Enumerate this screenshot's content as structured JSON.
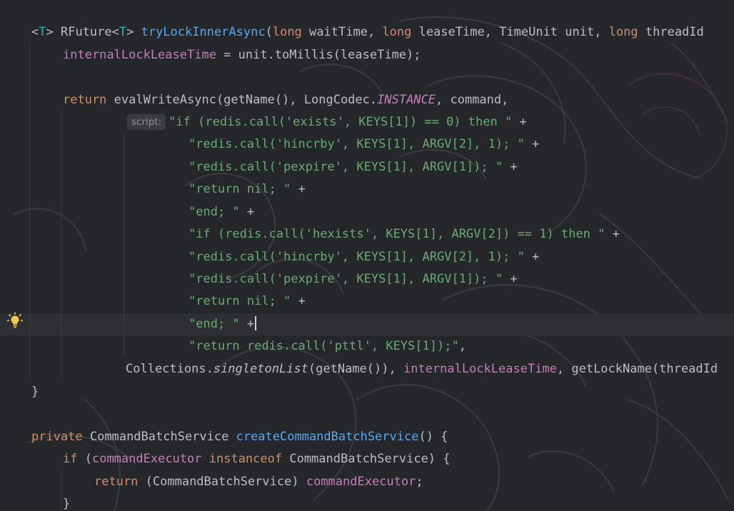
{
  "editor": {
    "language": "java",
    "inlay_hint": "script:",
    "lines": [
      {
        "tokens": [
          {
            "t": "<",
            "c": "plain"
          },
          {
            "t": "T",
            "c": "type-param"
          },
          {
            "t": "> RFuture<",
            "c": "plain"
          },
          {
            "t": "T",
            "c": "type-param"
          },
          {
            "t": "> ",
            "c": "plain"
          },
          {
            "t": "tryLockInnerAsync",
            "c": "method-decl"
          },
          {
            "t": "(",
            "c": "plain"
          },
          {
            "t": "long",
            "c": "keyword"
          },
          {
            "t": " waitTime, ",
            "c": "plain"
          },
          {
            "t": "long",
            "c": "keyword"
          },
          {
            "t": " leaseTime, TimeUnit unit, ",
            "c": "plain"
          },
          {
            "t": "long",
            "c": "keyword"
          },
          {
            "t": " threadId",
            "c": "plain"
          }
        ]
      },
      {
        "tokens": [
          {
            "t": "internalLockLeaseTime",
            "c": "field"
          },
          {
            "t": " = unit.toMillis(leaseTime);",
            "c": "plain"
          }
        ]
      },
      {
        "tokens": []
      },
      {
        "tokens": [
          {
            "t": "return",
            "c": "keyword"
          },
          {
            "t": " evalWriteAsync(getName(), LongCodec.",
            "c": "plain"
          },
          {
            "t": "INSTANCE",
            "c": "static-field"
          },
          {
            "t": ", command,",
            "c": "plain"
          }
        ]
      },
      {
        "tokens": [
          {
            "t": "\"if (redis.call('exists', KEYS[1]) == 0) then \"",
            "c": "string"
          },
          {
            "t": " +",
            "c": "plain"
          }
        ]
      },
      {
        "tokens": [
          {
            "t": "\"redis.call('hincrby', KEYS[1], ARGV[2], 1); \"",
            "c": "string"
          },
          {
            "t": " +",
            "c": "plain"
          }
        ]
      },
      {
        "tokens": [
          {
            "t": "\"redis.call('pexpire', KEYS[1], ARGV[1]); \"",
            "c": "string"
          },
          {
            "t": " +",
            "c": "plain"
          }
        ]
      },
      {
        "tokens": [
          {
            "t": "\"return nil; \"",
            "c": "string"
          },
          {
            "t": " +",
            "c": "plain"
          }
        ]
      },
      {
        "tokens": [
          {
            "t": "\"end; \"",
            "c": "string"
          },
          {
            "t": " +",
            "c": "plain"
          }
        ]
      },
      {
        "tokens": [
          {
            "t": "\"if (redis.call('hexists', KEYS[1], ARGV[2]) == 1) then \"",
            "c": "string"
          },
          {
            "t": " +",
            "c": "plain"
          }
        ]
      },
      {
        "tokens": [
          {
            "t": "\"redis.call('hincrby', KEYS[1], ARGV[2], 1); \"",
            "c": "string"
          },
          {
            "t": " +",
            "c": "plain"
          }
        ]
      },
      {
        "tokens": [
          {
            "t": "\"redis.call('pexpire', KEYS[1], ARGV[1]); \"",
            "c": "string"
          },
          {
            "t": " +",
            "c": "plain"
          }
        ]
      },
      {
        "tokens": [
          {
            "t": "\"return nil; \"",
            "c": "string"
          },
          {
            "t": " +",
            "c": "plain"
          }
        ]
      },
      {
        "tokens": [
          {
            "t": "\"end; \"",
            "c": "string"
          },
          {
            "t": " +",
            "c": "plain"
          }
        ]
      },
      {
        "tokens": [
          {
            "t": "\"return redis.call('pttl', KEYS[1]);\"",
            "c": "string"
          },
          {
            "t": ",",
            "c": "plain"
          }
        ]
      },
      {
        "tokens": [
          {
            "t": "Collections.",
            "c": "plain"
          },
          {
            "t": "singletonList",
            "c": "static-method"
          },
          {
            "t": "(getName()), ",
            "c": "plain"
          },
          {
            "t": "internalLockLeaseTime",
            "c": "field"
          },
          {
            "t": ", getLockName(threadId",
            "c": "plain"
          }
        ]
      },
      {
        "tokens": [
          {
            "t": "}",
            "c": "plain"
          }
        ]
      },
      {
        "tokens": []
      },
      {
        "tokens": [
          {
            "t": "private",
            "c": "keyword"
          },
          {
            "t": " CommandBatchService ",
            "c": "plain"
          },
          {
            "t": "createCommandBatchService",
            "c": "method-decl"
          },
          {
            "t": "() {",
            "c": "plain"
          }
        ]
      },
      {
        "tokens": [
          {
            "t": "if",
            "c": "keyword"
          },
          {
            "t": " (",
            "c": "plain"
          },
          {
            "t": "commandExecutor",
            "c": "field"
          },
          {
            "t": " ",
            "c": "plain"
          },
          {
            "t": "instanceof",
            "c": "keyword"
          },
          {
            "t": " CommandBatchService) {",
            "c": "plain"
          }
        ]
      },
      {
        "tokens": [
          {
            "t": "return",
            "c": "keyword"
          },
          {
            "t": " (CommandBatchService) ",
            "c": "plain"
          },
          {
            "t": "commandExecutor",
            "c": "field"
          },
          {
            "t": ";",
            "c": "plain"
          }
        ]
      },
      {
        "tokens": [
          {
            "t": "}",
            "c": "plain"
          }
        ]
      }
    ]
  },
  "gutter": {
    "intention_icon": "lightbulb-icon"
  },
  "colors": {
    "background": "#26272b",
    "current_line": "#2e2f33",
    "plain": "#bcbec4",
    "keyword": "#cf8e6d",
    "type_param": "#16baac",
    "method_decl": "#56a8f5",
    "field": "#c77dbb",
    "string": "#6aab73",
    "bulb": "#f2c94c"
  }
}
